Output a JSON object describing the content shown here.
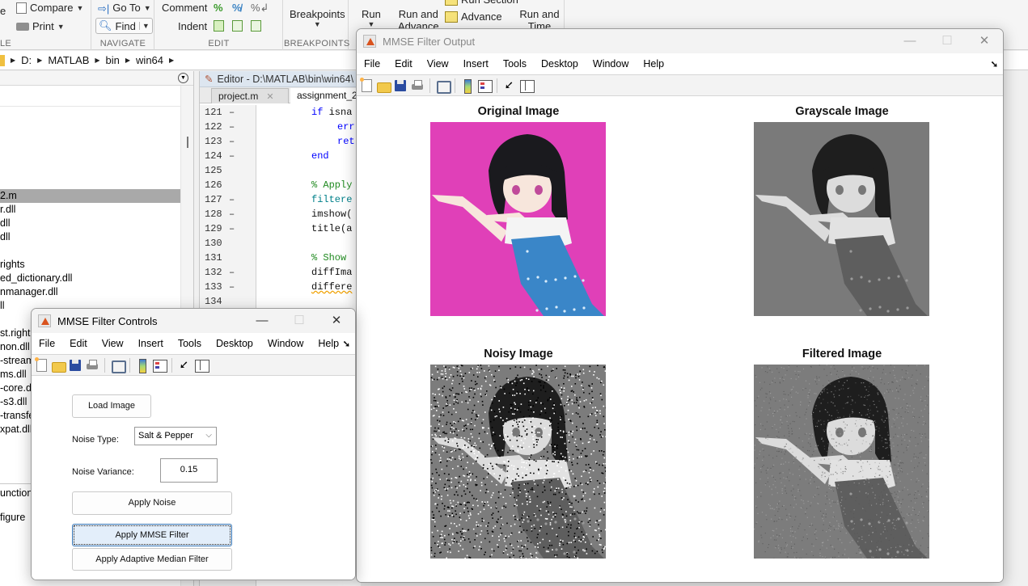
{
  "toolstrip": {
    "groups": [
      {
        "label": "LE"
      },
      {
        "label": "NAVIGATE"
      },
      {
        "label": "EDIT"
      },
      {
        "label": "BREAKPOINTS"
      }
    ],
    "file_partial": "e",
    "compare": "Compare",
    "print": "Print",
    "goto": "Go To",
    "find": "Find",
    "comment": "Comment",
    "indent": "Indent",
    "breakpoints": "Breakpoints",
    "run": "Run",
    "run_and_advance": "Run and Advance",
    "run_section": "Run Section",
    "advance": "Advance",
    "run_and_time": "Run and Time"
  },
  "address_bar": {
    "crumbs": [
      "D:",
      "MATLAB",
      "bin",
      "win64"
    ]
  },
  "folder_panel": {
    "files": [
      {
        "name": "2.m",
        "selected": true
      },
      {
        "name": "r.dll",
        "selected": false
      },
      {
        "name": "dll",
        "selected": false
      },
      {
        "name": "dll",
        "selected": false
      },
      {
        "name": "",
        "selected": false
      },
      {
        "name": "rights",
        "selected": false
      },
      {
        "name": "ed_dictionary.dll",
        "selected": false
      },
      {
        "name": "nmanager.dll",
        "selected": false
      },
      {
        "name": "ll",
        "selected": false
      },
      {
        "name": "",
        "selected": false
      },
      {
        "name": "st.right",
        "selected": false
      },
      {
        "name": "non.dll",
        "selected": false
      },
      {
        "name": "-stream",
        "selected": false
      },
      {
        "name": "ms.dll",
        "selected": false
      },
      {
        "name": "-core.d",
        "selected": false
      },
      {
        "name": "-s3.dll",
        "selected": false
      },
      {
        "name": "-transfe",
        "selected": false
      },
      {
        "name": "xpat.dll",
        "selected": false
      }
    ],
    "details_header": "unction",
    "details_line": "figure"
  },
  "editor": {
    "title": "Editor - D:\\MATLAB\\bin\\win64\\",
    "tabs": [
      {
        "label": "project.m",
        "active": false
      },
      {
        "label": "assignment_2",
        "active": true
      }
    ],
    "lines": [
      {
        "num": "121",
        "dash": "–",
        "text": "if isna",
        "cls": "kw-if"
      },
      {
        "num": "122",
        "dash": "–",
        "text": "err",
        "cls": "kw"
      },
      {
        "num": "123",
        "dash": "–",
        "text": "ret",
        "cls": "kw"
      },
      {
        "num": "124",
        "dash": "–",
        "text": "end",
        "cls": "kw"
      },
      {
        "num": "125",
        "dash": "",
        "text": "",
        "cls": "tx"
      },
      {
        "num": "126",
        "dash": "",
        "text": "% Apply",
        "cls": "cm"
      },
      {
        "num": "127",
        "dash": "–",
        "text": "filtere",
        "cls": "fn"
      },
      {
        "num": "128",
        "dash": "–",
        "text": "imshow(",
        "cls": "tx"
      },
      {
        "num": "129",
        "dash": "–",
        "text": "title(a",
        "cls": "tx"
      },
      {
        "num": "130",
        "dash": "",
        "text": "",
        "cls": "tx"
      },
      {
        "num": "131",
        "dash": "",
        "text": "% Show",
        "cls": "cm"
      },
      {
        "num": "132",
        "dash": "–",
        "text": "diffIma",
        "cls": "tx"
      },
      {
        "num": "133",
        "dash": "–",
        "text": "differe",
        "cls": "warn"
      },
      {
        "num": "134",
        "dash": "",
        "text": "",
        "cls": "tx"
      }
    ]
  },
  "output_fig": {
    "title": "MMSE Filter Output",
    "menu": [
      "File",
      "Edit",
      "View",
      "Insert",
      "Tools",
      "Desktop",
      "Window",
      "Help"
    ],
    "toolbar_icons": [
      "new-figure-icon",
      "open-file-icon",
      "save-icon",
      "print-icon",
      "link-plot-icon",
      "insert-colorbar-icon",
      "insert-legend-icon",
      "edit-plot-pointer-icon",
      "property-inspector-icon"
    ],
    "axes": [
      {
        "title": "Original Image",
        "kind": "original"
      },
      {
        "title": "Grayscale Image",
        "kind": "grayscale"
      },
      {
        "title": "Noisy Image",
        "kind": "noisy"
      },
      {
        "title": "Filtered Image",
        "kind": "filtered"
      }
    ],
    "colors": {
      "original_background": "#e040b8",
      "dress": "#3a86c8",
      "gray_background": "#7a7a7a"
    }
  },
  "controls_fig": {
    "title": "MMSE Filter Controls",
    "menu": [
      "File",
      "Edit",
      "View",
      "Insert",
      "Tools",
      "Desktop",
      "Window",
      "Help"
    ],
    "load_button": "Load Image",
    "noise_type_label": "Noise Type:",
    "noise_type_value": "Salt & Pepper",
    "noise_variance_label": "Noise Variance:",
    "noise_variance_value": "0.15",
    "apply_noise_button": "Apply Noise",
    "apply_mmse_button": "Apply MMSE Filter",
    "apply_adaptive_button": "Apply Adaptive Median Filter"
  }
}
